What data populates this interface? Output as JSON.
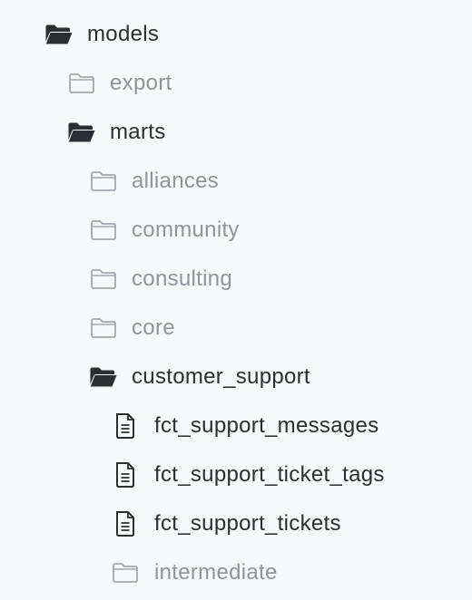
{
  "tree": {
    "models": {
      "label": "models",
      "icon": "folder-open-icon"
    },
    "export": {
      "label": "export",
      "icon": "folder-icon"
    },
    "marts": {
      "label": "marts",
      "icon": "folder-open-icon"
    },
    "alliances": {
      "label": "alliances",
      "icon": "folder-icon"
    },
    "community": {
      "label": "community",
      "icon": "folder-icon"
    },
    "consulting": {
      "label": "consulting",
      "icon": "folder-icon"
    },
    "core": {
      "label": "core",
      "icon": "folder-icon"
    },
    "customer_support": {
      "label": "customer_support",
      "icon": "folder-open-icon"
    },
    "fct_support_messages": {
      "label": "fct_support_messages",
      "icon": "file-text-icon"
    },
    "fct_support_ticket_tags": {
      "label": "fct_support_ticket_tags",
      "icon": "file-text-icon"
    },
    "fct_support_tickets": {
      "label": "fct_support_tickets",
      "icon": "file-text-icon"
    },
    "intermediate": {
      "label": "intermediate",
      "icon": "folder-icon"
    }
  },
  "colors": {
    "background": "#f7f8fa",
    "text_dark": "#2b2e33",
    "text_muted": "#8f949b",
    "icon_dark": "#2b2e33",
    "icon_muted": "#a3a8ae"
  }
}
